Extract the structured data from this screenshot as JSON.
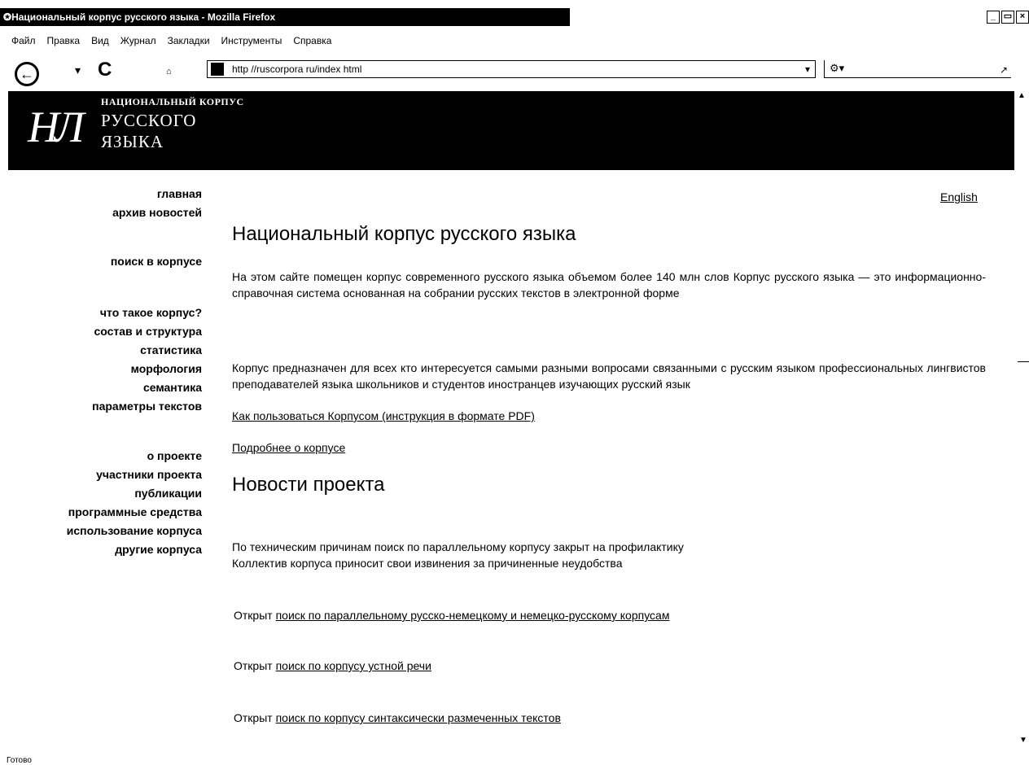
{
  "window": {
    "title": "Национальный корпус русского языка - Mozilla Firefox",
    "controls": [
      "_",
      "▭",
      "×"
    ]
  },
  "menu": [
    "Файл",
    "Правка",
    "Вид",
    "Журнал",
    "Закладки",
    "Инструменты",
    "Справка"
  ],
  "toolbar": {
    "url": "http //ruscorpora ru/index html",
    "search_placeholder": "",
    "icons": [
      "back-icon",
      "dropdown-icon",
      "reload-icon",
      "home-icon",
      "search-engine-icon"
    ]
  },
  "banner": {
    "logo_mark": "НЛ",
    "line1": "НАЦИОНАЛЬНЫЙ КОРПУС",
    "line2": "РУССКОГО",
    "line3": "ЯЗЫКА"
  },
  "sidebar": {
    "group1": [
      "главная",
      "архив новостей"
    ],
    "group2": [
      "поиск в корпусе"
    ],
    "group3": [
      "что такое корпус?",
      "состав и структура",
      "статистика",
      "морфология",
      "семантика",
      "параметры текстов"
    ],
    "group4": [
      "о проекте",
      "участники проекта",
      "публикации",
      "программные средства",
      "использование корпуса",
      "другие корпуса"
    ]
  },
  "lang_link": "English",
  "main": {
    "heading": "Национальный корпус русского языка",
    "para1": "На этом сайте помещен корпус современного русского языка объемом более 140 млн слов  Корпус русского языка — это информационно-справочная система  основанная на собрании русских текстов в электронной форме",
    "para2": "Корпус предназначен для всех  кто интересуется самыми разными вопросами  связанными с русским языком  профессиональных лингвистов  преподавателей языка  школьников и студентов  иностранцев  изучающих русский язык",
    "link_pdf": "Как пользоваться Корпусом (инструкция в формате PDF)",
    "link_more": "Подробнее о корпусе",
    "news_heading": "Новости проекта",
    "news_line1": "По техническим причинам поиск по параллельному корпусу закрыт на профилактику",
    "news_line2": "Коллектив корпуса приносит свои извинения за причиненные неудобства",
    "opened_prefix": "Открыт",
    "news_links": [
      "поиск по параллельному русско-немецкому и немецко-русскому корпусам",
      "поиск по корпусу устной речи",
      "поиск по корпусу синтаксически размеченных текстов"
    ]
  },
  "status": "Готово"
}
